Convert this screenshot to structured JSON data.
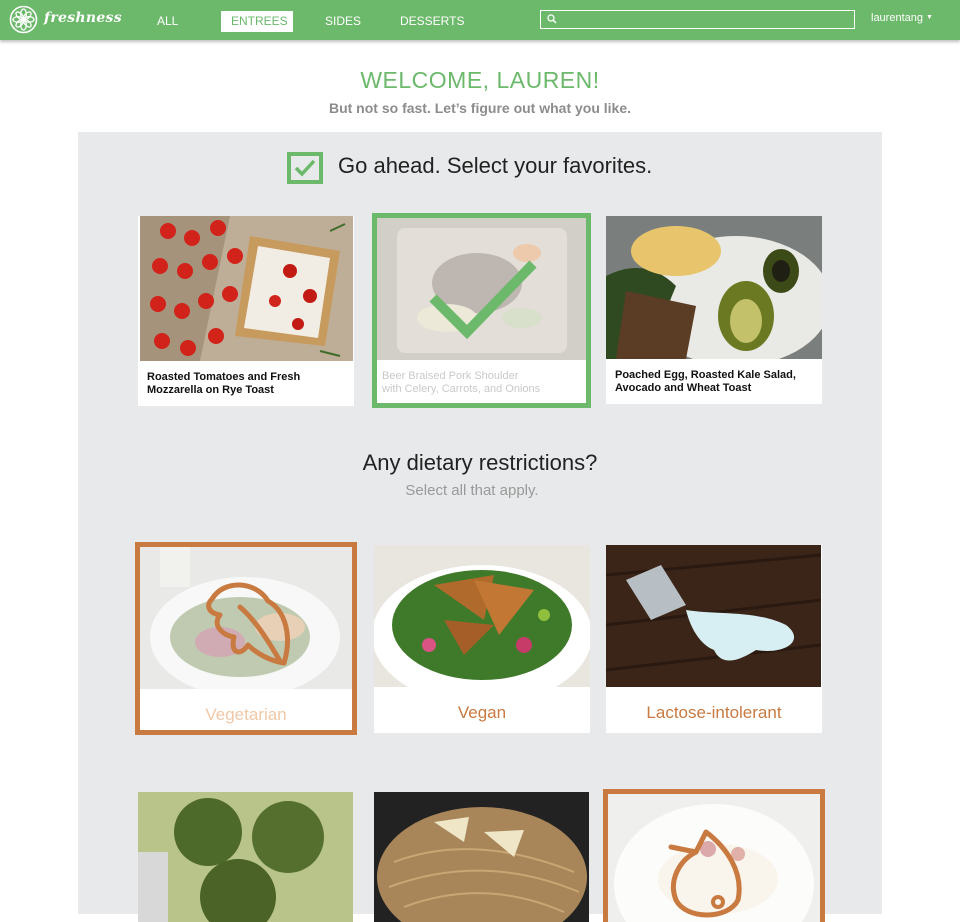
{
  "app": {
    "logo_text": "freshness"
  },
  "nav": {
    "items": [
      "ALL",
      "ENTREES",
      "SIDES",
      "DESSERTS"
    ],
    "active": "ENTREES"
  },
  "search": {
    "placeholder": "",
    "icon": "search-icon"
  },
  "user": {
    "name": "laurentang"
  },
  "welcome": {
    "title": "WELCOME, LAUREN!",
    "subtitle": "But not so fast.  Let’s figure out what you like."
  },
  "favorites": {
    "heading": "Go ahead.  Select your favorites.",
    "items": [
      {
        "line1": "Roasted Tomatoes and Fresh",
        "line2": "Mozzarella on Rye Toast",
        "selected": false
      },
      {
        "line1": "Beer Braised Pork Shoulder",
        "line2": "with Celery, Carrots, and Onions",
        "selected": true
      },
      {
        "line1": "Poached Egg, Roasted Kale Salad,",
        "line2": "Avocado and Wheat Toast",
        "selected": false
      }
    ]
  },
  "diet": {
    "heading": "Any dietary restrictions?",
    "subheading": "Select all that apply.",
    "items": [
      {
        "label": "Vegetarian",
        "selected": true,
        "icon": "leaf-icon"
      },
      {
        "label": "Vegan",
        "selected": false
      },
      {
        "label": "Lactose-intolerant",
        "selected": false
      }
    ]
  },
  "colors": {
    "brand_green": "#6cb96b",
    "accent_orange": "#c87a41",
    "panel_gray": "#e8e9ea"
  }
}
